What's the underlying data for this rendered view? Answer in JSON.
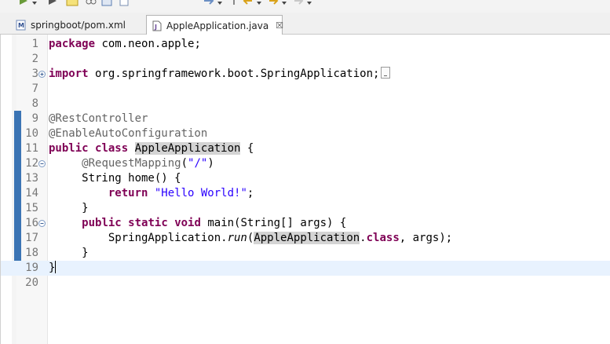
{
  "tabs": [
    {
      "label": "springboot/pom.xml",
      "icon": "maven-file-icon",
      "active": false
    },
    {
      "label": "AppleApplication.java",
      "icon": "java-file-icon",
      "active": true,
      "close": "☒"
    }
  ],
  "editor": {
    "lines": [
      {
        "n": "1",
        "tokens": [
          {
            "t": "package",
            "c": "kw"
          },
          {
            "t": " com.neon.apple;",
            "c": "plain"
          }
        ]
      },
      {
        "n": "2",
        "tokens": []
      },
      {
        "n": "3",
        "fold": "expand",
        "tokens": [
          {
            "t": "import",
            "c": "kw"
          },
          {
            "t": " org.springframework.boot.SpringApplication;",
            "c": "plain"
          }
        ],
        "collapsed": true
      },
      {
        "n": "7",
        "tokens": []
      },
      {
        "n": "8",
        "tokens": []
      },
      {
        "n": "9",
        "tokens": [
          {
            "t": "@RestController",
            "c": "ann"
          }
        ]
      },
      {
        "n": "10",
        "tokens": [
          {
            "t": "@EnableAutoConfiguration",
            "c": "ann"
          }
        ]
      },
      {
        "n": "11",
        "tokens": [
          {
            "t": "public",
            "c": "kw"
          },
          {
            "t": " ",
            "c": "plain"
          },
          {
            "t": "class",
            "c": "kw"
          },
          {
            "t": " ",
            "c": "plain"
          },
          {
            "t": "AppleApplication",
            "c": "plain occ"
          },
          {
            "t": " {",
            "c": "plain"
          }
        ]
      },
      {
        "n": "12",
        "fold": "collapse",
        "tokens": [
          {
            "t": "     ",
            "c": "plain"
          },
          {
            "t": "@RequestMapping",
            "c": "ann"
          },
          {
            "t": "(",
            "c": "plain"
          },
          {
            "t": "\"/\"",
            "c": "str"
          },
          {
            "t": ")",
            "c": "plain"
          }
        ]
      },
      {
        "n": "13",
        "tokens": [
          {
            "t": "     String home() {",
            "c": "plain"
          }
        ]
      },
      {
        "n": "14",
        "tokens": [
          {
            "t": "         ",
            "c": "plain"
          },
          {
            "t": "return",
            "c": "kw"
          },
          {
            "t": " ",
            "c": "plain"
          },
          {
            "t": "\"Hello World!\"",
            "c": "str"
          },
          {
            "t": ";",
            "c": "plain"
          }
        ]
      },
      {
        "n": "15",
        "tokens": [
          {
            "t": "     }",
            "c": "plain"
          }
        ]
      },
      {
        "n": "16",
        "fold": "collapse",
        "tokens": [
          {
            "t": "     ",
            "c": "plain"
          },
          {
            "t": "public",
            "c": "kw"
          },
          {
            "t": " ",
            "c": "plain"
          },
          {
            "t": "static",
            "c": "kw"
          },
          {
            "t": " ",
            "c": "plain"
          },
          {
            "t": "void",
            "c": "kw"
          },
          {
            "t": " main(String[] args) {",
            "c": "plain"
          }
        ]
      },
      {
        "n": "17",
        "tokens": [
          {
            "t": "         SpringApplication.",
            "c": "plain"
          },
          {
            "t": "run",
            "c": "plain italic"
          },
          {
            "t": "(",
            "c": "plain"
          },
          {
            "t": "AppleApplication",
            "c": "plain occ"
          },
          {
            "t": ".",
            "c": "plain"
          },
          {
            "t": "class",
            "c": "kw"
          },
          {
            "t": ", args);",
            "c": "plain"
          }
        ]
      },
      {
        "n": "18",
        "tokens": [
          {
            "t": "     }",
            "c": "plain"
          }
        ]
      },
      {
        "n": "19",
        "current": true,
        "cursor": true,
        "tokens": [
          {
            "t": "}",
            "c": "plain"
          }
        ]
      },
      {
        "n": "20",
        "tokens": []
      }
    ]
  },
  "colors": {
    "keyword": "#7f0055",
    "annotation": "#646464",
    "string": "#2a00ff",
    "quick_diff": "#3b74b4",
    "current_line": "#e8f2fe"
  }
}
